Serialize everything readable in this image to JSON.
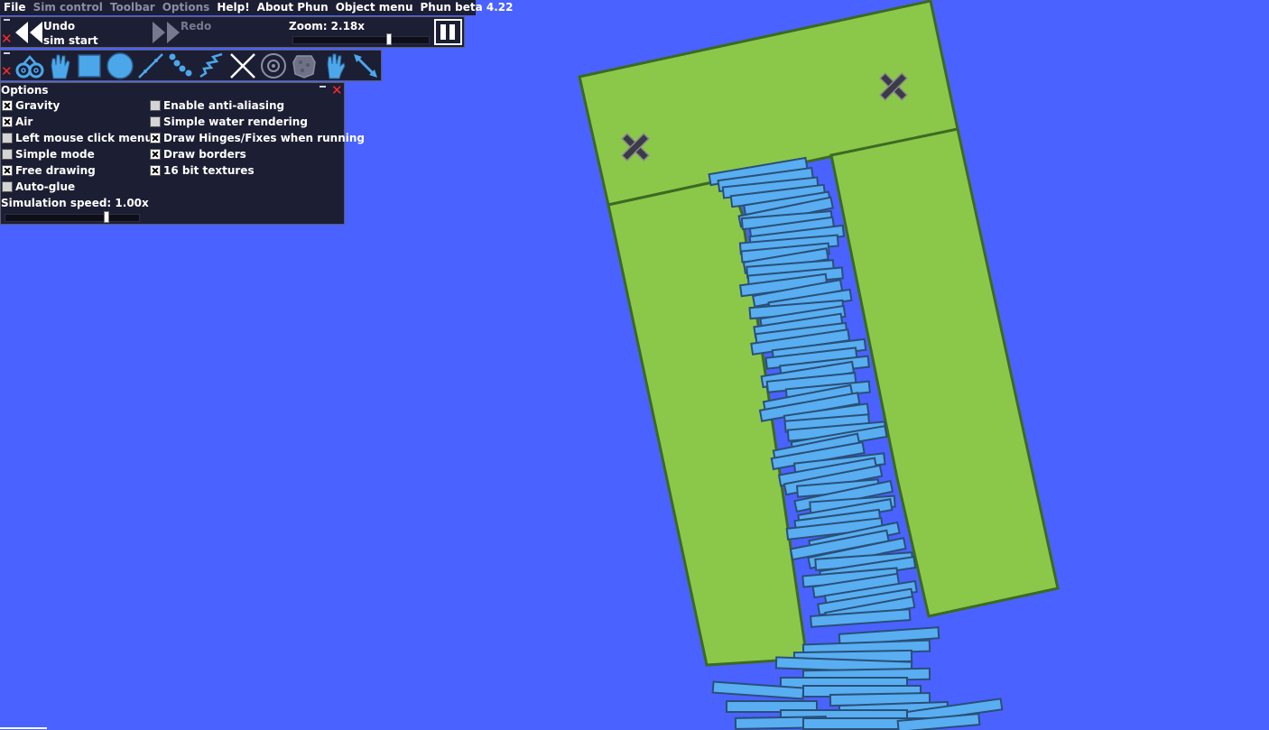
{
  "menu": {
    "items": [
      {
        "label": "File",
        "enabled": true
      },
      {
        "label": "Sim control",
        "enabled": false
      },
      {
        "label": "Toolbar",
        "enabled": false
      },
      {
        "label": "Options",
        "enabled": false
      },
      {
        "label": "Help!",
        "enabled": true
      },
      {
        "label": "About Phun",
        "enabled": true
      },
      {
        "label": "Object menu",
        "enabled": true
      },
      {
        "label": "Phun beta 4.22",
        "enabled": true
      }
    ]
  },
  "sim_control": {
    "undo_line1": "Undo",
    "undo_line2": "sim start",
    "redo_label": "Redo",
    "zoom_text": "Zoom: 2.18x"
  },
  "toolbar": {
    "tools": [
      "chain-icon",
      "drag-hand-icon",
      "box-icon",
      "circle-icon",
      "spring-line-icon",
      "chain-beads-icon",
      "zigzag-spring-icon",
      "fixate-icon",
      "hinge-icon",
      "sponge-icon",
      "glove-icon",
      "laser-arrow-icon"
    ]
  },
  "options": {
    "title": "Options",
    "checkboxes": [
      {
        "label": "Gravity",
        "checked": true
      },
      {
        "label": "Air",
        "checked": true
      },
      {
        "label": "Left mouse click menus",
        "checked": false
      },
      {
        "label": "Simple mode",
        "checked": false
      },
      {
        "label": "Free drawing",
        "checked": true
      },
      {
        "label": "Auto-glue",
        "checked": false
      },
      {
        "label": "Enable anti-aliasing",
        "checked": false
      },
      {
        "label": "Simple water rendering",
        "checked": false
      },
      {
        "label": "Draw Hinges/Fixes when running",
        "checked": true
      },
      {
        "label": "Draw borders",
        "checked": true
      },
      {
        "label": "16 bit textures",
        "checked": true
      }
    ],
    "speed_text": "Simulation speed: 1.00x",
    "simulation_speed": 1.0
  },
  "colors": {
    "background": "#4a62ff",
    "container_fill": "#8bc84a",
    "container_border": "#3d6a22",
    "plank_fill": "#58aef0",
    "plank_border": "#2a4f78",
    "panel": "#1c1e33",
    "close_red": "#ff2a2a"
  }
}
